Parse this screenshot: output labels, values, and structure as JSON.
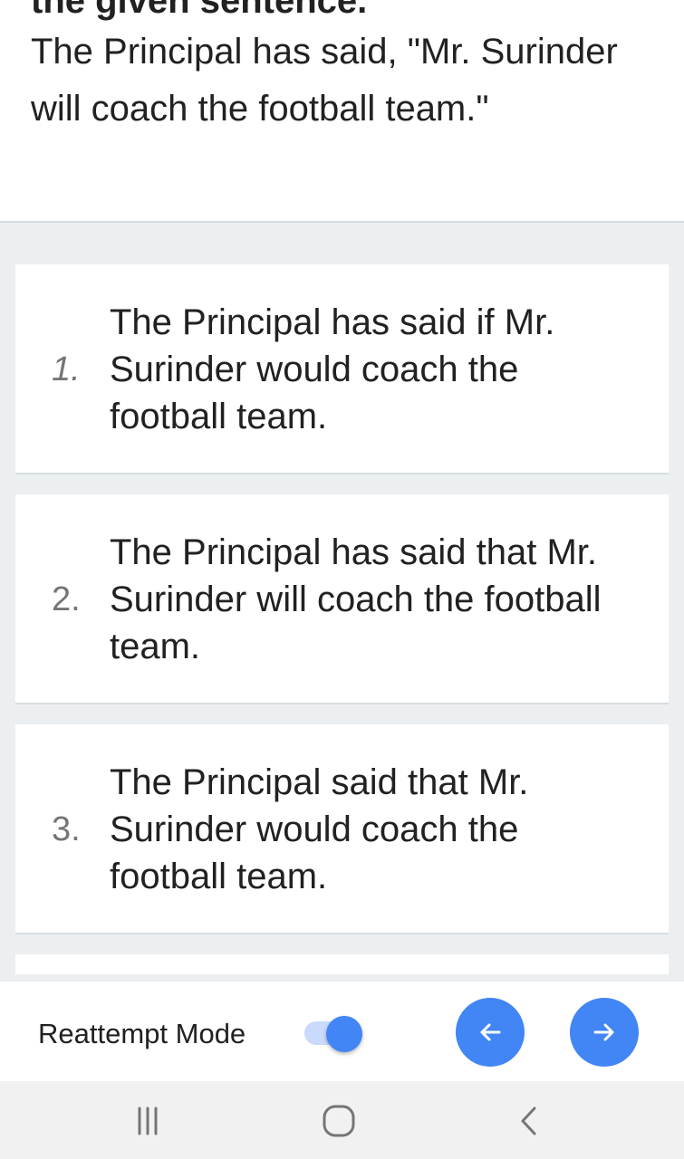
{
  "question": {
    "heading": "the given sentence.",
    "text": "The Principal has said, \"Mr. Surinder will coach the football team.\""
  },
  "options": [
    {
      "number": "1.",
      "text": "The Principal has said if Mr. Surinder would coach the football team."
    },
    {
      "number": "2.",
      "text": "The Principal has said that Mr. Surinder will coach the football team."
    },
    {
      "number": "3.",
      "text": "The Principal said that Mr. Surinder would coach the football team."
    }
  ],
  "bottom_bar": {
    "reattempt_label": "Reattempt Mode",
    "reattempt_on": true
  },
  "icons": {
    "prev": "arrow-left-icon",
    "next": "arrow-right-icon",
    "recents": "recents-icon",
    "home": "home-icon",
    "back": "back-icon"
  },
  "colors": {
    "accent": "#4285f4",
    "page_background": "#eceff1",
    "card": "#ffffff",
    "option_number": "#757575"
  }
}
